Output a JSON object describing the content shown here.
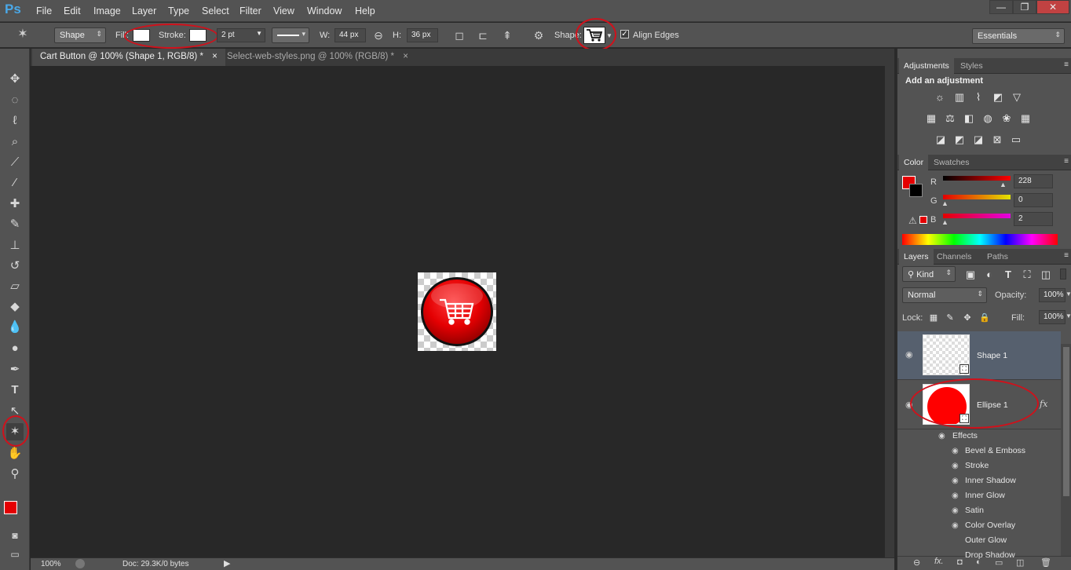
{
  "menubar": {
    "logo": "Ps",
    "items": [
      "File",
      "Edit",
      "Image",
      "Layer",
      "Type",
      "Select",
      "Filter",
      "View",
      "Window",
      "Help"
    ],
    "window_controls": [
      "—",
      "❐",
      "✕"
    ]
  },
  "options": {
    "mode": "Shape",
    "fill_label": "Fill:",
    "stroke_label": "Stroke:",
    "stroke_width": "2 pt",
    "w_label": "W:",
    "w_value": "44 px",
    "h_label": "H:",
    "h_value": "36 px",
    "shape_label": "Shape:",
    "align_edges_label": "Align Edges",
    "align_edges_checked": true,
    "workspace": "Essentials"
  },
  "tabs": [
    {
      "label": "Cart Button  @ 100% (Shape 1, RGB/8) *",
      "active": true
    },
    {
      "label": "Select-web-styles.png @ 100% (RGB/8) *",
      "active": false
    }
  ],
  "status": {
    "zoom": "100%",
    "doc": "Doc: 29.3K/0 bytes"
  },
  "adjustments": {
    "tabs": [
      "Adjustments",
      "Styles"
    ],
    "heading": "Add an adjustment"
  },
  "color_panel": {
    "tabs": [
      "Color",
      "Swatches"
    ],
    "r_label": "R",
    "g_label": "G",
    "b_label": "B",
    "r": "228",
    "g": "0",
    "b": "2",
    "foreground": "#e40002",
    "background": "#000000"
  },
  "layers_panel": {
    "tabs": [
      "Layers",
      "Channels",
      "Paths"
    ],
    "filter_kind": "Kind",
    "blend_mode": "Normal",
    "opacity_label": "Opacity:",
    "opacity": "100%",
    "lock_label": "Lock:",
    "fill_label": "Fill:",
    "fill": "100%",
    "layers": [
      {
        "name": "Shape 1",
        "selected": true
      },
      {
        "name": "Ellipse 1",
        "selected": false,
        "fx": "fx"
      }
    ],
    "effects_label": "Effects",
    "effects": [
      "Bevel & Emboss",
      "Stroke",
      "Inner Shadow",
      "Inner Glow",
      "Satin",
      "Color Overlay",
      "Outer Glow",
      "Drop Shadow"
    ]
  },
  "colors": {
    "accent_red": "#d0111b",
    "button_red": "#e40002",
    "panel": "#535353"
  }
}
